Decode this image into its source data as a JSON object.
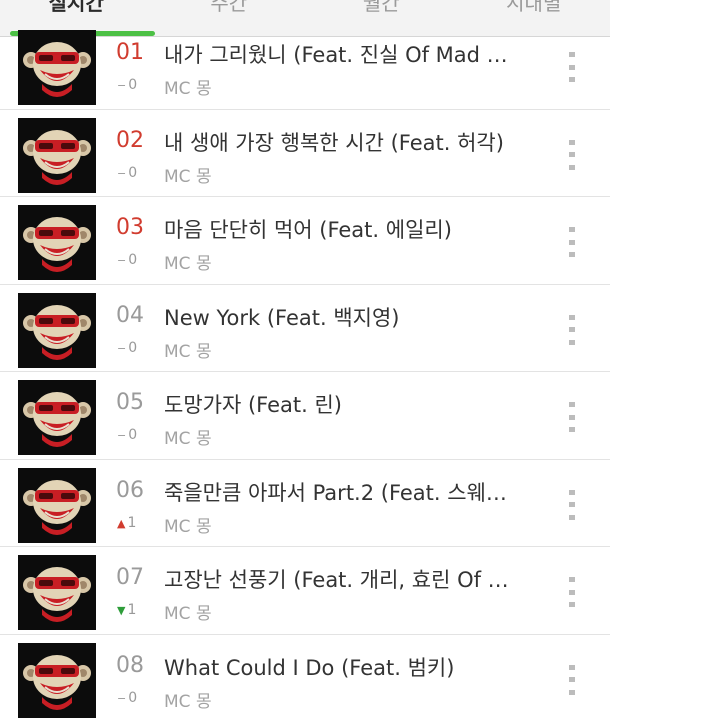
{
  "tabs": [
    "실시간",
    "주간",
    "월간",
    "시대별"
  ],
  "artist": "MC 몽",
  "songs": [
    {
      "rank": "01",
      "title": "내가 그리웠니 (Feat. 진실 Of Mad …",
      "change": "0",
      "dir": "same"
    },
    {
      "rank": "02",
      "title": "내 생애 가장 행복한 시간 (Feat. 허각)",
      "change": "0",
      "dir": "same"
    },
    {
      "rank": "03",
      "title": "마음 단단히 먹어 (Feat. 에일리)",
      "change": "0",
      "dir": "same"
    },
    {
      "rank": "04",
      "title": "New York (Feat. 백지영)",
      "change": "0",
      "dir": "same"
    },
    {
      "rank": "05",
      "title": "도망가자 (Feat. 린)",
      "change": "0",
      "dir": "same"
    },
    {
      "rank": "06",
      "title": "죽을만큼 아파서 Part.2 (Feat. 스웨…",
      "change": "1",
      "dir": "up"
    },
    {
      "rank": "07",
      "title": "고장난 선풍기 (Feat. 개리, 효린 Of …",
      "change": "1",
      "dir": "down"
    },
    {
      "rank": "08",
      "title": "What Could I Do (Feat. 범키)",
      "change": "0",
      "dir": "same"
    }
  ],
  "icons": {
    "thumbnail": "monkey-album-art-icon",
    "menu": "more-vertical-icon"
  }
}
